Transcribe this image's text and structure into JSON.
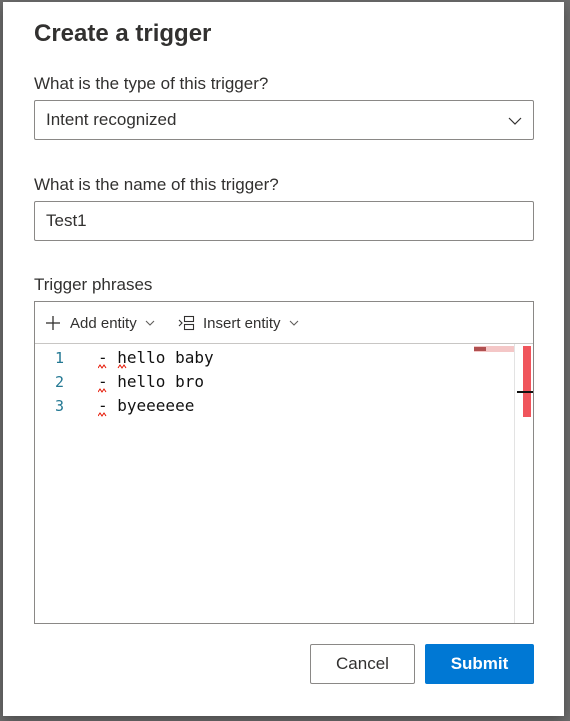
{
  "dialog": {
    "title": "Create a trigger",
    "type_label": "What is the type of this trigger?",
    "type_value": "Intent recognized",
    "name_label": "What is the name of this trigger?",
    "name_value": "Test1",
    "phrases_label": "Trigger phrases",
    "toolbar": {
      "add_entity": "Add entity",
      "insert_entity": "Insert entity"
    },
    "editor": {
      "lines": [
        {
          "number": "1",
          "text": "- hello baby"
        },
        {
          "number": "2",
          "text": "- hello bro"
        },
        {
          "number": "3",
          "text": "- byeeeeee"
        }
      ]
    },
    "cancel_label": "Cancel",
    "submit_label": "Submit"
  },
  "colors": {
    "accent": "#0078d4",
    "line_number": "#237893",
    "error_squiggle": "#e51400",
    "scroll_marker": "#f0555c"
  },
  "icons": {
    "type_dropdown": "chevron-down-icon",
    "add_entity": "plus-icon",
    "insert_entity": "insert-entity-icon"
  }
}
